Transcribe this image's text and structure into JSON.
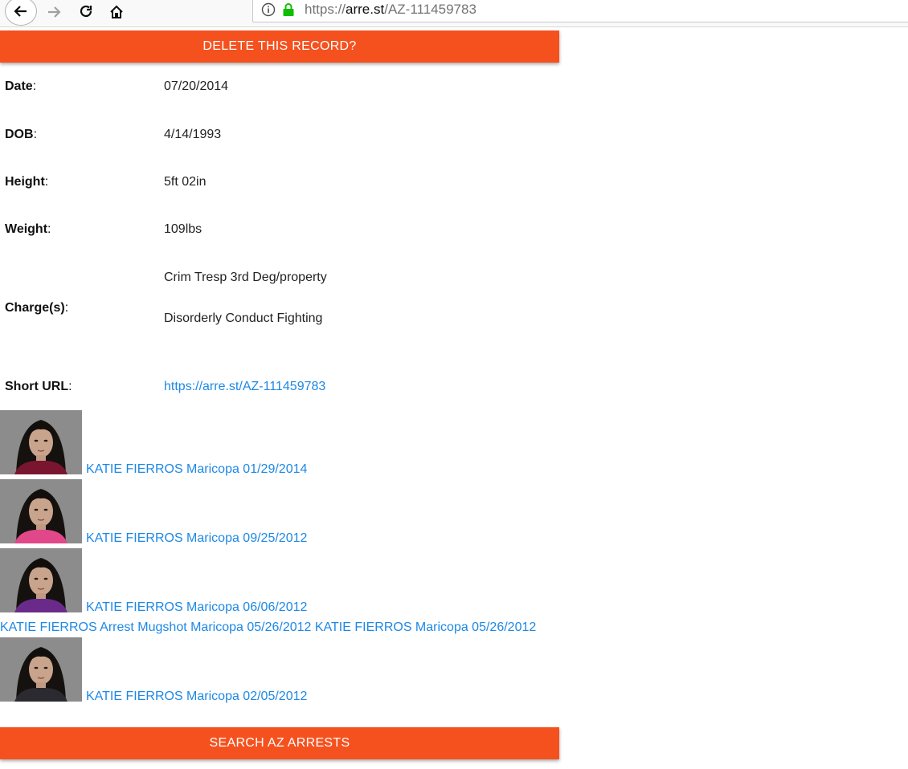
{
  "browser": {
    "url_scheme": "https://",
    "url_host": "arre.st",
    "url_path": "/AZ-111459783"
  },
  "buttons": {
    "delete_label": "DELETE THIS RECORD?",
    "search_label": "SEARCH AZ ARRESTS"
  },
  "details": {
    "date_label": "Date",
    "date_value": "07/20/2014",
    "dob_label": "DOB",
    "dob_value": "4/14/1993",
    "height_label": "Height",
    "height_value": "5ft 02in",
    "weight_label": "Weight",
    "weight_value": "109lbs",
    "charges_label": "Charge(s)",
    "charges": [
      "Crim Tresp 3rd Deg/property",
      "Disorderly Conduct Fighting"
    ],
    "short_url_label": "Short URL",
    "short_url_value": "https://arre.st/AZ-111459783"
  },
  "records": [
    {
      "label": "KATIE FIERROS Maricopa 01/29/2014",
      "shirt": "#7a1530"
    },
    {
      "label": "KATIE FIERROS Maricopa 09/25/2012",
      "shirt": "#e0488a"
    },
    {
      "label": "KATIE FIERROS Maricopa 06/06/2012",
      "shirt": "#6a2a8a"
    },
    {
      "label": "KATIE FIERROS Arrest Mugshot Maricopa 05/26/2012 KATIE FIERROS Maricopa 05/26/2012"
    },
    {
      "label": "KATIE FIERROS Maricopa 02/05/2012",
      "shirt": "#2a2a30"
    }
  ],
  "colors": {
    "accent": "#f5511e",
    "link": "#1e88e5"
  }
}
